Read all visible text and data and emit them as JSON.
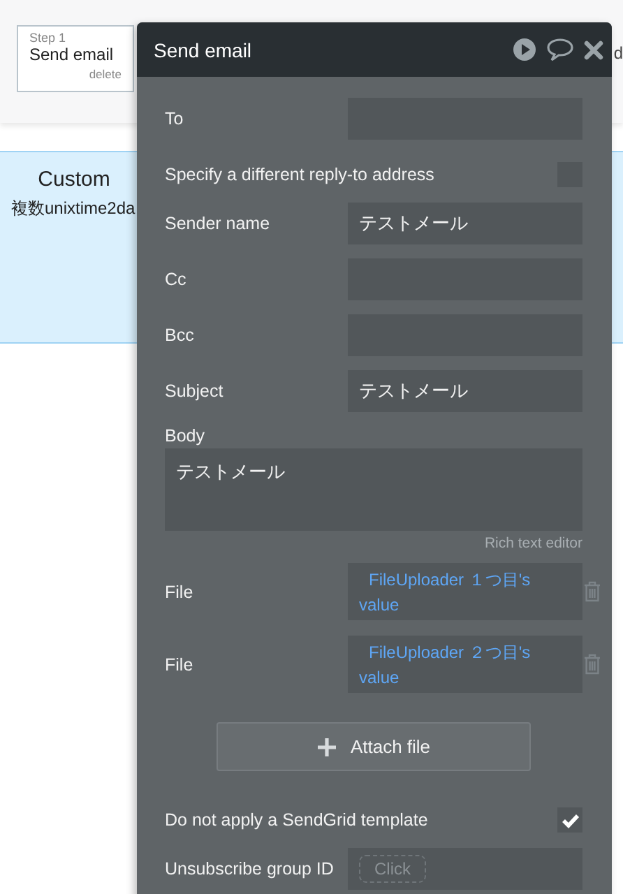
{
  "step": {
    "number": "Step 1",
    "title": "Send email",
    "delete": "delete"
  },
  "next_step_fragment": "d",
  "custom_card": {
    "title": "Custom",
    "subtitle": "複数unixtime2da"
  },
  "panel": {
    "title": "Send email",
    "fields": [
      {
        "kind": "input",
        "label": "To"
      },
      {
        "kind": "checkbox",
        "label": "Specify a different reply-to address",
        "checked": false
      },
      {
        "kind": "input",
        "label": "Sender name",
        "value": "テストメール"
      },
      {
        "kind": "input",
        "label": "Cc"
      },
      {
        "kind": "input",
        "label": "Bcc"
      },
      {
        "kind": "input",
        "label": "Subject",
        "value": "テストメール"
      },
      {
        "kind": "textarea",
        "label": "Body",
        "value": "テストメール",
        "hint": "Rich text editor"
      },
      {
        "kind": "file",
        "label": "File",
        "value": "FileUploader １つ目's value"
      },
      {
        "kind": "file",
        "label": "File",
        "value": "FileUploader ２つ目's value"
      },
      {
        "kind": "button",
        "label": "Attach file"
      },
      {
        "kind": "checkbox",
        "label": "Do not apply a SendGrid template",
        "checked": true
      },
      {
        "kind": "click",
        "label": "Unsubscribe group ID",
        "placeholder": "Click"
      }
    ]
  }
}
